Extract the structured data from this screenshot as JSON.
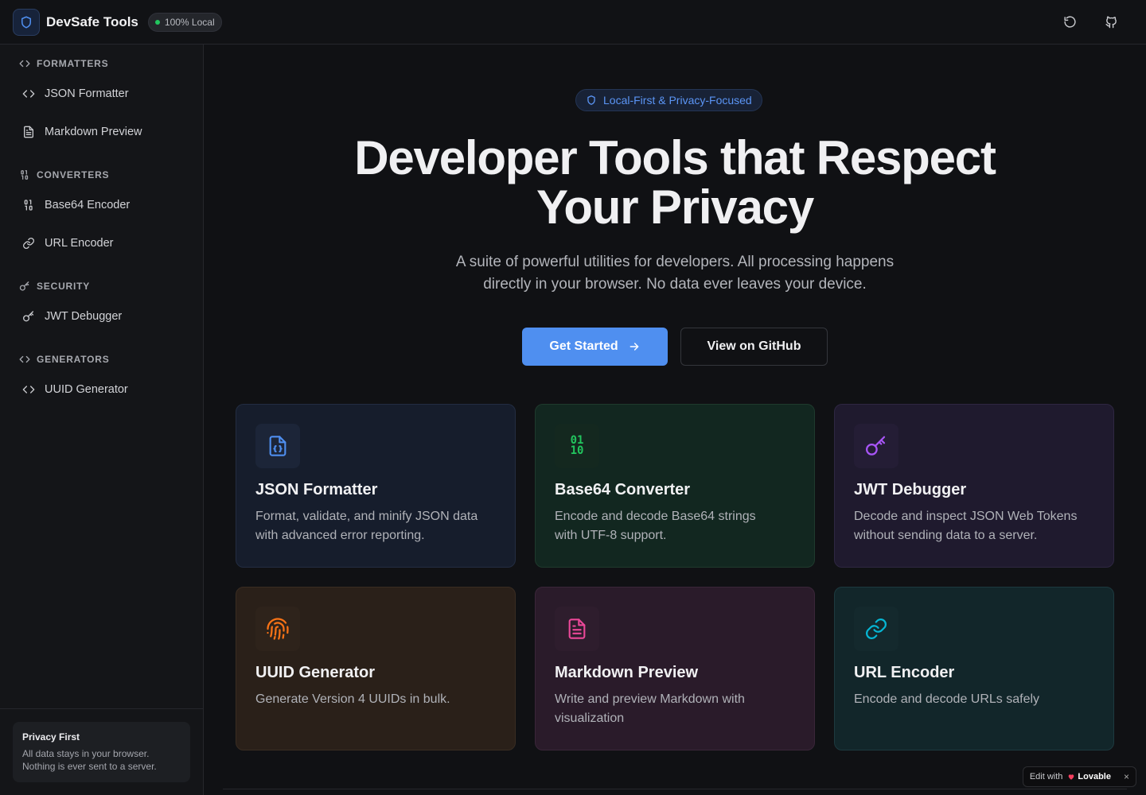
{
  "header": {
    "app_title": "DevSafe Tools",
    "badge": "100% Local",
    "icons": [
      "shield-icon",
      "refresh-icon",
      "github-icon"
    ]
  },
  "sidebar": {
    "sections": [
      {
        "title": "FORMATTERS",
        "icon": "code-icon",
        "items": [
          {
            "label": "JSON Formatter",
            "icon": "code-icon"
          },
          {
            "label": "Markdown Preview",
            "icon": "file-text-icon"
          }
        ]
      },
      {
        "title": "CONVERTERS",
        "icon": "binary-icon",
        "items": [
          {
            "label": "Base64 Encoder",
            "icon": "binary-icon"
          },
          {
            "label": "URL Encoder",
            "icon": "link-icon"
          }
        ]
      },
      {
        "title": "SECURITY",
        "icon": "key-icon",
        "items": [
          {
            "label": "JWT Debugger",
            "icon": "key-icon"
          }
        ]
      },
      {
        "title": "GENERATORS",
        "icon": "code-icon",
        "items": [
          {
            "label": "UUID Generator",
            "icon": "code-icon"
          }
        ]
      }
    ],
    "privacy": {
      "title": "Privacy First",
      "text_line1": "All data stays in your browser.",
      "text_line2": "Nothing is ever sent to a server."
    }
  },
  "hero": {
    "badge": "Local-First & Privacy-Focused",
    "title_line1": "Developer Tools that Respect",
    "title_line2": "Your Privacy",
    "subtitle_line1": "A suite of powerful utilities for developers. All processing happens",
    "subtitle_line2": "directly in your browser. No data ever leaves your device.",
    "primary_button": "Get Started",
    "secondary_button": "View on GitHub"
  },
  "cards": [
    {
      "title": "JSON Formatter",
      "desc_line1": "Format, validate, and minify JSON data",
      "desc_line2": "with advanced error reporting.",
      "icon": "file-json-icon",
      "accent": "#4f8ff0"
    },
    {
      "title": "Base64 Converter",
      "desc_line1": "Encode and decode Base64 strings",
      "desc_line2": "with UTF-8 support.",
      "icon": "binary-icon",
      "accent": "#22c55e",
      "icon_text_top": "01",
      "icon_text_bottom": "10"
    },
    {
      "title": "JWT Debugger",
      "desc_line1": "Decode and inspect JSON Web Tokens",
      "desc_line2": "without sending data to a server.",
      "icon": "key-icon",
      "accent": "#a855f7"
    },
    {
      "title": "UUID Generator",
      "desc_line1": "Generate Version 4 UUIDs in bulk.",
      "desc_line2": "",
      "icon": "fingerprint-icon",
      "accent": "#f97316"
    },
    {
      "title": "Markdown Preview",
      "desc_line1": "Write and preview Markdown with",
      "desc_line2": "visualization",
      "icon": "file-text-icon",
      "accent": "#ec4899"
    },
    {
      "title": "URL Encoder",
      "desc_line1": "Encode and decode URLs safely",
      "desc_line2": "",
      "icon": "link-icon",
      "accent": "#06b6d4"
    }
  ],
  "lovable": {
    "prefix": "Edit with",
    "brand": "Lovable",
    "close": "×"
  }
}
